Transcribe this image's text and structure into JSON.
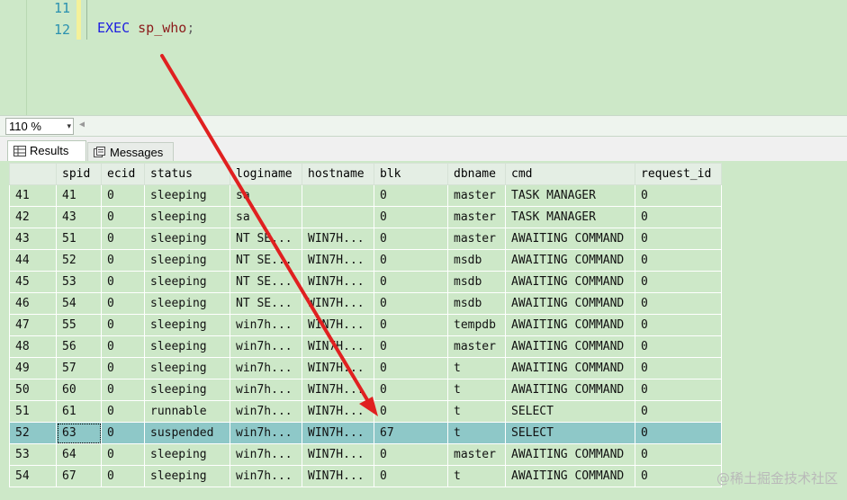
{
  "editor": {
    "lines": [
      {
        "number": "11",
        "code": ""
      },
      {
        "number": "12",
        "keyword": "EXEC",
        "proc": "sp_who",
        "terminator": ";"
      }
    ]
  },
  "zoom": {
    "value": "110 %",
    "arrow": "▾",
    "scroll_left": "◀"
  },
  "tabs": {
    "results": {
      "label": "Results",
      "icon": "grid-icon"
    },
    "messages": {
      "label": "Messages",
      "icon": "messages-icon"
    }
  },
  "grid": {
    "columns": [
      "",
      "spid",
      "ecid",
      "status",
      "loginame",
      "hostname",
      "blk",
      "dbname",
      "cmd",
      "request_id"
    ],
    "rows": [
      [
        "41",
        "41",
        "0",
        "sleeping",
        "sa",
        "",
        "0",
        "master",
        "TASK MANAGER",
        "0"
      ],
      [
        "42",
        "43",
        "0",
        "sleeping",
        "sa",
        "",
        "0",
        "master",
        "TASK MANAGER",
        "0"
      ],
      [
        "43",
        "51",
        "0",
        "sleeping",
        "NT SE...",
        "WIN7H...",
        "0",
        "master",
        "AWAITING COMMAND",
        "0"
      ],
      [
        "44",
        "52",
        "0",
        "sleeping",
        "NT SE...",
        "WIN7H...",
        "0",
        "msdb",
        "AWAITING COMMAND",
        "0"
      ],
      [
        "45",
        "53",
        "0",
        "sleeping",
        "NT SE...",
        "WIN7H...",
        "0",
        "msdb",
        "AWAITING COMMAND",
        "0"
      ],
      [
        "46",
        "54",
        "0",
        "sleeping",
        "NT SE...",
        "WIN7H...",
        "0",
        "msdb",
        "AWAITING COMMAND",
        "0"
      ],
      [
        "47",
        "55",
        "0",
        "sleeping",
        "win7h...",
        "WIN7H...",
        "0",
        "tempdb",
        "AWAITING COMMAND",
        "0"
      ],
      [
        "48",
        "56",
        "0",
        "sleeping",
        "win7h...",
        "WIN7H...",
        "0",
        "master",
        "AWAITING COMMAND",
        "0"
      ],
      [
        "49",
        "57",
        "0",
        "sleeping",
        "win7h...",
        "WIN7H...",
        "0",
        "t",
        "AWAITING COMMAND",
        "0"
      ],
      [
        "50",
        "60",
        "0",
        "sleeping",
        "win7h...",
        "WIN7H...",
        "0",
        "t",
        "AWAITING COMMAND",
        "0"
      ],
      [
        "51",
        "61",
        "0",
        "runnable",
        "win7h...",
        "WIN7H...",
        "0",
        "t",
        "SELECT",
        "0"
      ],
      [
        "52",
        "63",
        "0",
        "suspended",
        "win7h...",
        "WIN7H...",
        "67",
        "t",
        "SELECT",
        "0"
      ],
      [
        "53",
        "64",
        "0",
        "sleeping",
        "win7h...",
        "WIN7H...",
        "0",
        "master",
        "AWAITING COMMAND",
        "0"
      ],
      [
        "54",
        "67",
        "0",
        "sleeping",
        "win7h...",
        "WIN7H...",
        "0",
        "t",
        "AWAITING COMMAND",
        "0"
      ]
    ],
    "selected_row": "52"
  },
  "annotation": {
    "color": "#e02020",
    "meaning": "arrow from EXEC sp_who to blk value"
  },
  "watermark": "@稀土掘金技术社区",
  "colors": {
    "grid_bg": "#cde8c8",
    "selected_row": "#8ec8c8",
    "keyword": "#1d1de0",
    "line_number": "#2b91af"
  }
}
